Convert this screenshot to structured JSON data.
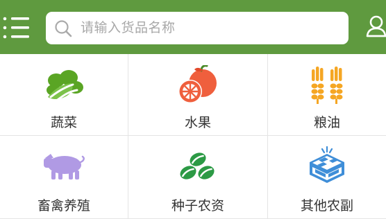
{
  "header": {
    "background": "#5f9a3f",
    "menu_icon": "menu-icon",
    "user_icon": "user-icon"
  },
  "search": {
    "placeholder": "请输入货品名称",
    "icon": "search-icon"
  },
  "categories": [
    {
      "label": "蔬菜",
      "icon": "vegetable-icon",
      "color": "#5aa524"
    },
    {
      "label": "水果",
      "icon": "fruit-icon",
      "color": "#ef5f3d"
    },
    {
      "label": "粮油",
      "icon": "grain-icon",
      "color": "#f5a623"
    },
    {
      "label": "畜禽养殖",
      "icon": "pig-icon",
      "color": "#b09ae4"
    },
    {
      "label": "种子农资",
      "icon": "seed-icon",
      "color": "#2c9a45"
    },
    {
      "label": "其他农副",
      "icon": "other-produce-icon",
      "color": "#3f8ed8"
    }
  ]
}
